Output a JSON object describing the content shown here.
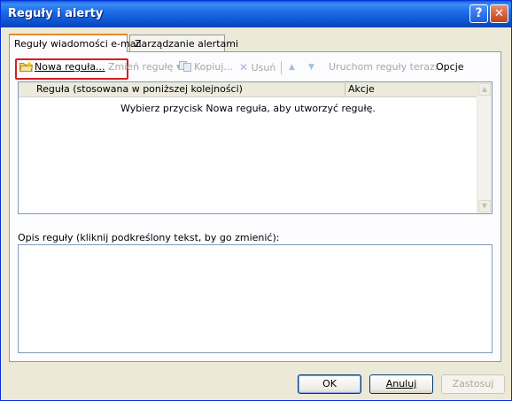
{
  "window": {
    "title": "Reguły i alerty",
    "help_glyph": "?",
    "close_glyph": "✕"
  },
  "tabs": [
    {
      "label": "Reguły wiadomości e-mail",
      "active": true
    },
    {
      "label": "Zarządzanie alertami",
      "active": false
    }
  ],
  "toolbar": {
    "new_rule": "Nowa reguła...",
    "change_rule": "Zmień regułę",
    "dropdown_glyph": "▾",
    "copy": "Kopiuj...",
    "delete_glyph": "✕",
    "delete": "Usuń",
    "up_glyph": "▲",
    "down_glyph": "▼",
    "run_rules": "Uruchom reguły teraz...",
    "options": "Opcje",
    "highlight_color": "#d32020"
  },
  "rules_grid": {
    "col_rule": "Reguła (stosowana w poniższej kolejności)",
    "col_actions": "Akcje",
    "empty_message": "Wybierz przycisk Nowa reguła, aby utworzyć regułę.",
    "scroll_up": "▲",
    "scroll_down": "▼"
  },
  "description": {
    "label": "Opis reguły (kliknij podkreślony tekst, by go zmienić):"
  },
  "buttons": {
    "ok": "OK",
    "cancel": "Anuluj",
    "apply": "Zastosuj"
  }
}
